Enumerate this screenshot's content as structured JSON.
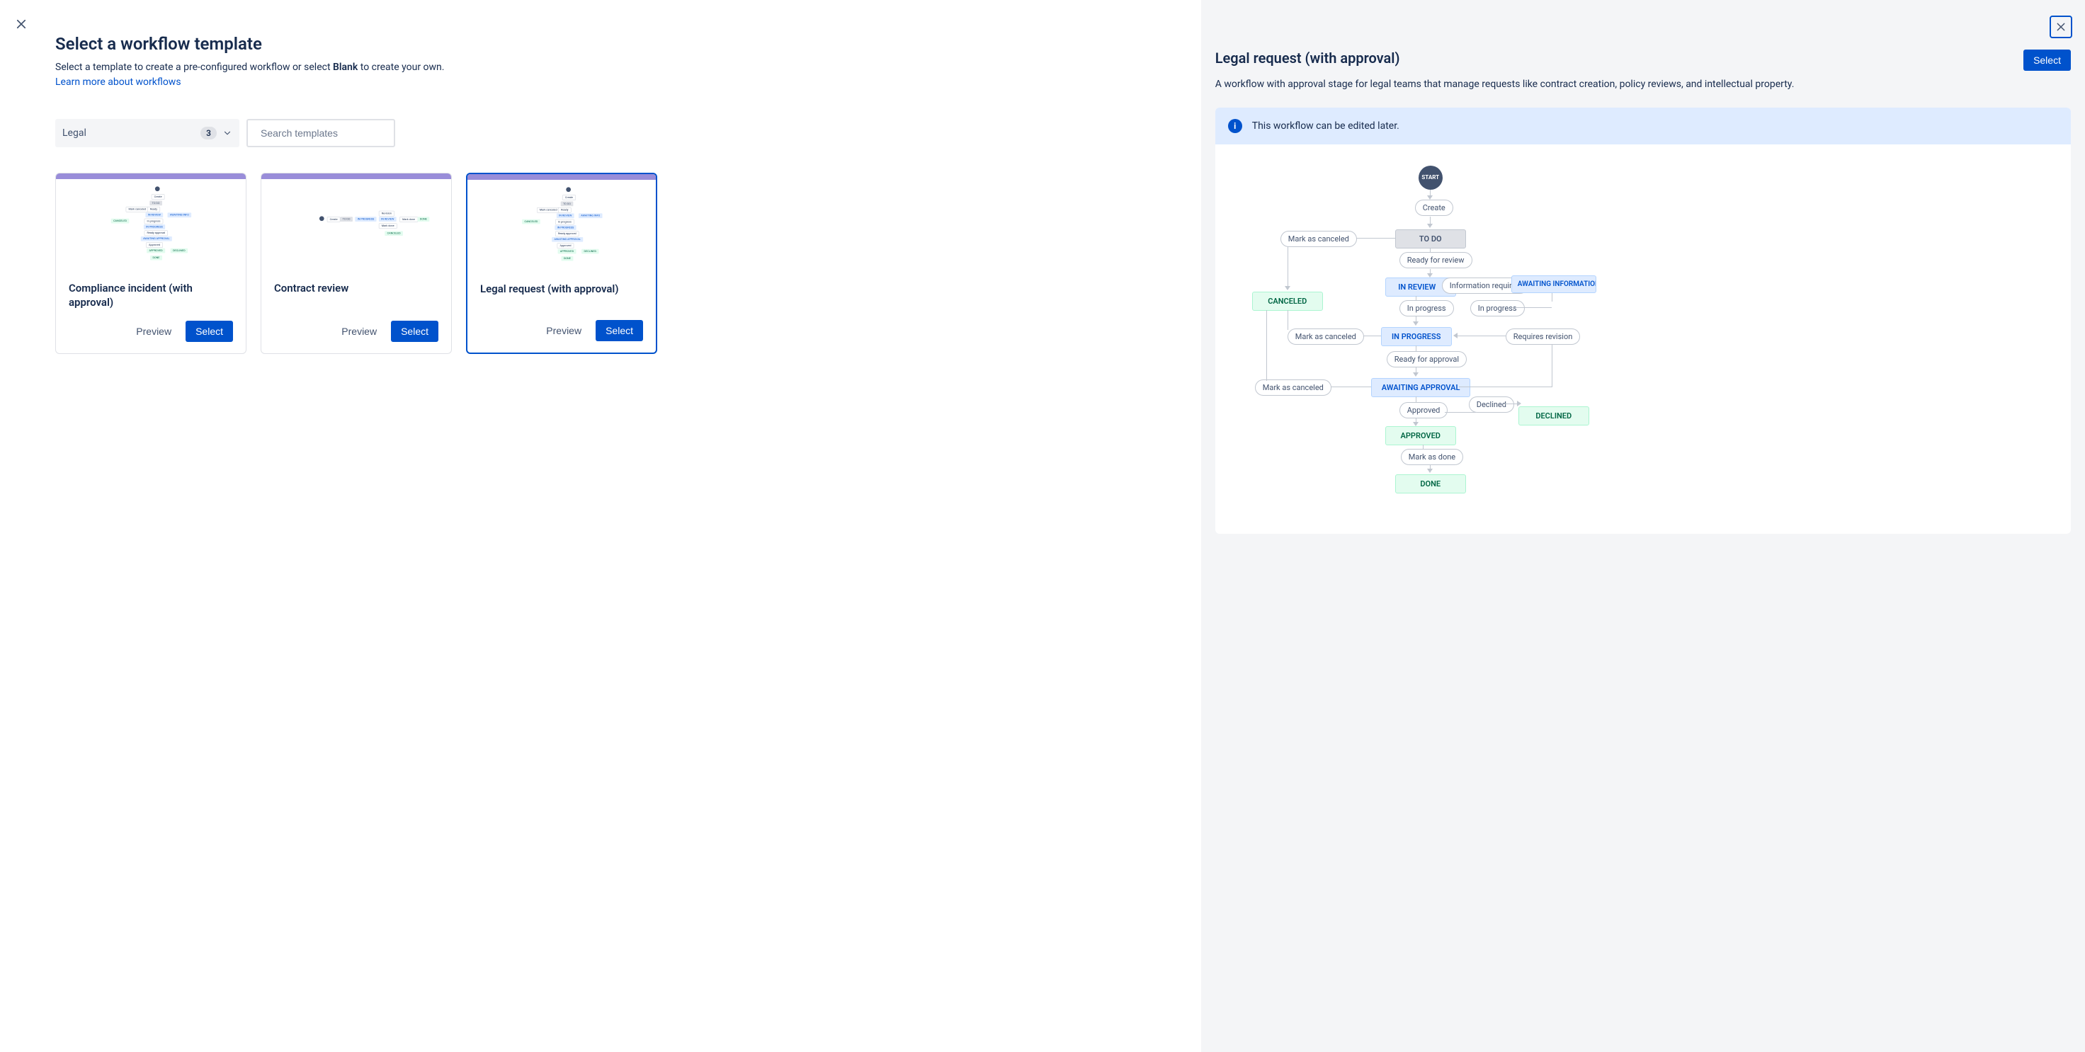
{
  "left": {
    "title": "Select a workflow template",
    "desc_prefix": "Select a template to create a pre-configured workflow or select ",
    "desc_bold": "Blank",
    "desc_suffix": " to create your own.",
    "learn_link": "Learn more about workflows",
    "filter": {
      "label": "Legal",
      "count": "3"
    },
    "search_placeholder": "Search templates",
    "cards": [
      {
        "title": "Compliance incident (with approval)",
        "preview": "Preview",
        "select": "Select"
      },
      {
        "title": "Contract review",
        "preview": "Preview",
        "select": "Select"
      },
      {
        "title": "Legal request (with approval)",
        "preview": "Preview",
        "select": "Select"
      }
    ]
  },
  "right": {
    "title": "Legal request (with approval)",
    "select": "Select",
    "desc": "A workflow with approval stage for legal teams that manage requests like contract creation, policy reviews, and intellectual property.",
    "info": "This workflow can be edited later.",
    "flow": {
      "start": "START",
      "pills": {
        "create": "Create",
        "mark_canceled_1": "Mark as canceled",
        "ready_review": "Ready for review",
        "info_required": "Information required",
        "in_progress_1": "In progress",
        "in_progress_2": "In progress",
        "mark_canceled_2": "Mark as canceled",
        "requires_revision": "Requires revision",
        "ready_approval": "Ready for approval",
        "mark_canceled_3": "Mark as canceled",
        "approved": "Approved",
        "declined": "Declined",
        "mark_done": "Mark as done"
      },
      "nodes": {
        "todo": "TO DO",
        "in_review": "IN REVIEW",
        "awaiting_info": "AWAITING INFORMATION",
        "canceled": "CANCELED",
        "in_progress": "IN PROGRESS",
        "awaiting_approval": "AWAITING APPROVAL",
        "approved": "APPROVED",
        "declined": "DECLINED",
        "done": "DONE"
      }
    }
  }
}
